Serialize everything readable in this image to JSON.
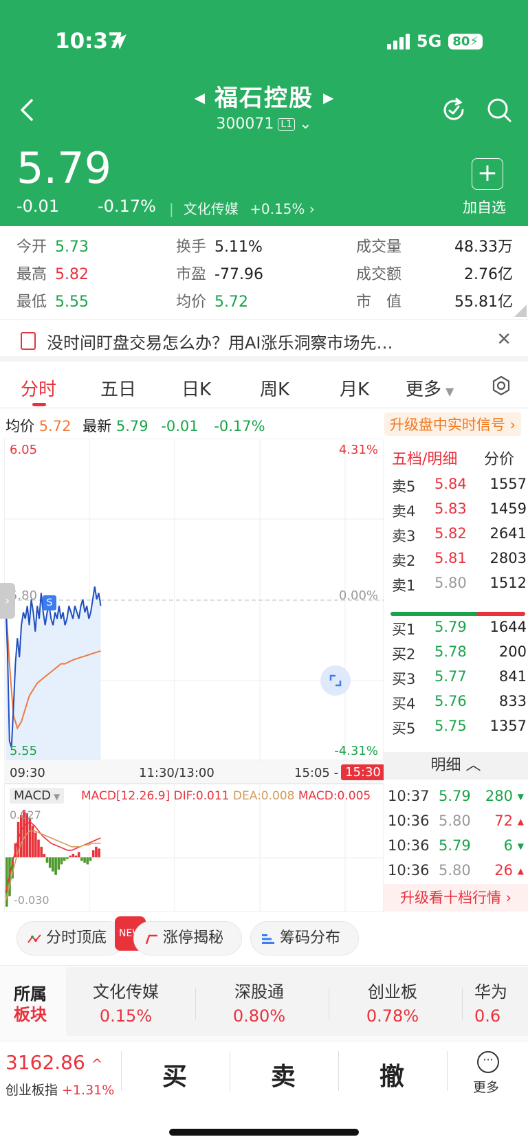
{
  "status_bar": {
    "time": "10:37",
    "network": "5G",
    "battery": "80"
  },
  "header": {
    "stock_name": "福石控股",
    "stock_code": "300071",
    "level_badge": "L1",
    "price": "5.79",
    "change": "-0.01",
    "change_pct": "-0.17%",
    "sector_name": "文化传媒",
    "sector_change": "+0.15%",
    "add_watch_label": "加自选",
    "colors": {
      "header_bg": "#27ae60"
    }
  },
  "stats": {
    "open": {
      "label": "今开",
      "value": "5.73"
    },
    "high": {
      "label": "最高",
      "value": "5.82"
    },
    "low": {
      "label": "最低",
      "value": "5.55"
    },
    "turnover_rate": {
      "label": "换手",
      "value": "5.11%"
    },
    "pe": {
      "label": "市盈",
      "value": "-77.96"
    },
    "avg_price": {
      "label": "均价",
      "value": "5.72"
    },
    "volume": {
      "label": "成交量",
      "value": "48.33万"
    },
    "amount": {
      "label": "成交额",
      "value": "2.76亿"
    },
    "market_cap": {
      "label": "市　值",
      "value": "55.81亿"
    }
  },
  "notice": {
    "text": "没时间盯盘交易怎么办？用AI涨乐洞察市场先…"
  },
  "tabs": [
    "分时",
    "五日",
    "日K",
    "周K",
    "月K",
    "更多"
  ],
  "info_line": {
    "avg_label": "均价",
    "avg_value": "5.72",
    "latest_label": "最新",
    "latest_value": "5.79",
    "change": "-0.01",
    "change_pct": "-0.17%",
    "upgrade_label": "升级盘中实时信号"
  },
  "chart_data": {
    "type": "line",
    "y_max_label": "6.05",
    "y_mid_label": "5.80",
    "y_min_label": "5.55",
    "pct_max_label": "4.31%",
    "pct_mid_label": "0.00%",
    "pct_min_label": "-4.31%",
    "ylim": [
      5.55,
      6.05
    ],
    "x_labels": [
      "09:30",
      "11:30/13:00",
      "15:05 -",
      "15:30"
    ],
    "series": [
      {
        "values": [
          5.8,
          5.72,
          5.58,
          5.57,
          5.63,
          5.7,
          5.74,
          5.71,
          5.76,
          5.78,
          5.77,
          5.79,
          5.76,
          5.8,
          5.78,
          5.75,
          5.79,
          5.77,
          5.81,
          5.78,
          5.76,
          5.78,
          5.79,
          5.77,
          5.76,
          5.78,
          5.77,
          5.79,
          5.77,
          5.78,
          5.76,
          5.77,
          5.79,
          5.78,
          5.77,
          5.79,
          5.78,
          5.77,
          5.79,
          5.8,
          5.78,
          5.79,
          5.77,
          5.78,
          5.8,
          5.82,
          5.8,
          5.81,
          5.79
        ]
      },
      {
        "values": [
          5.8,
          5.7,
          5.62,
          5.6,
          5.61,
          5.63,
          5.65,
          5.66,
          5.67,
          5.675,
          5.68,
          5.685,
          5.69,
          5.695,
          5.7,
          5.7,
          5.703,
          5.706,
          5.708,
          5.71,
          5.712,
          5.714,
          5.716,
          5.718,
          5.72
        ]
      }
    ],
    "colors": {
      "price": "#1f4fbf",
      "avg": "#f07a3c"
    },
    "macd": {
      "indicator_label": "MACD",
      "params_label": "MACD[12.26.9]",
      "dif_label": "DIF:0.011",
      "dea_label": "DEA:0.008",
      "macd_label": "MACD:0.005",
      "top_label": "0.027",
      "bottom_label": "-0.030",
      "ylim": [
        -0.03,
        0.027
      ],
      "bars": [
        -0.028,
        -0.022,
        -0.012,
        0.008,
        0.02,
        0.024,
        0.027,
        0.025,
        0.022,
        0.018,
        0.014,
        0.01,
        0.006,
        0.002,
        -0.003,
        -0.006,
        -0.008,
        -0.01,
        -0.007,
        -0.004,
        -0.002,
        -0.001,
        0.001,
        0.002,
        0.001,
        0.003,
        -0.002,
        -0.003,
        -0.004,
        -0.002,
        0.004,
        0.006,
        0.005
      ],
      "dif": [
        -0.02,
        -0.01,
        0.0,
        0.01,
        0.016,
        0.019,
        0.02,
        0.018,
        0.015,
        0.012,
        0.01,
        0.008,
        0.007,
        0.006,
        0.005,
        0.004,
        0.004,
        0.005,
        0.006,
        0.007,
        0.008,
        0.009,
        0.01,
        0.011
      ],
      "dea": [
        -0.025,
        -0.016,
        -0.006,
        0.003,
        0.009,
        0.013,
        0.015,
        0.015,
        0.014,
        0.013,
        0.012,
        0.011,
        0.01,
        0.009,
        0.008,
        0.007,
        0.006,
        0.006,
        0.006,
        0.007,
        0.007,
        0.008,
        0.008,
        0.008
      ]
    }
  },
  "order_book": {
    "title": "五档/明细",
    "price_label": "分价",
    "asks": [
      {
        "label": "卖5",
        "price": "5.84",
        "vol": "1557"
      },
      {
        "label": "卖4",
        "price": "5.83",
        "vol": "1459"
      },
      {
        "label": "卖3",
        "price": "5.82",
        "vol": "2641"
      },
      {
        "label": "卖2",
        "price": "5.81",
        "vol": "2803"
      },
      {
        "label": "卖1",
        "price": "5.80",
        "vol": "1512"
      }
    ],
    "bids": [
      {
        "label": "买1",
        "price": "5.79",
        "vol": "1644"
      },
      {
        "label": "买2",
        "price": "5.78",
        "vol": "200"
      },
      {
        "label": "买3",
        "price": "5.77",
        "vol": "841"
      },
      {
        "label": "买4",
        "price": "5.76",
        "vol": "833"
      },
      {
        "label": "买5",
        "price": "5.75",
        "vol": "1357"
      }
    ],
    "detail_label": "明细",
    "details": [
      {
        "time": "10:37",
        "price": "5.79",
        "vol": "280",
        "dir": "down"
      },
      {
        "time": "10:36",
        "price": "5.80",
        "vol": "72",
        "dir": "up"
      },
      {
        "time": "10:36",
        "price": "5.79",
        "vol": "6",
        "dir": "down"
      },
      {
        "time": "10:36",
        "price": "5.80",
        "vol": "26",
        "dir": "up"
      }
    ],
    "upgrade_label": "升级看十档行情"
  },
  "chips": [
    {
      "label": "分时顶底",
      "icon": "trend-icon",
      "badge": "NEW"
    },
    {
      "label": "涨停揭秘",
      "icon": "limit-up-icon"
    },
    {
      "label": "筹码分布",
      "icon": "chip-distribution-icon"
    }
  ],
  "sectors": {
    "title_top": "所属",
    "title_bottom": "板块",
    "items": [
      {
        "name": "文化传媒",
        "pct": "0.15%"
      },
      {
        "name": "深股通",
        "pct": "0.80%"
      },
      {
        "name": "创业板",
        "pct": "0.78%"
      },
      {
        "name": "华为",
        "pct": "0.6"
      }
    ]
  },
  "bottom_bar": {
    "index_value": "3162.86",
    "index_name": "创业板指",
    "index_change": "+1.31%",
    "buy": "买",
    "sell": "卖",
    "cancel": "撤",
    "more": "更多"
  }
}
